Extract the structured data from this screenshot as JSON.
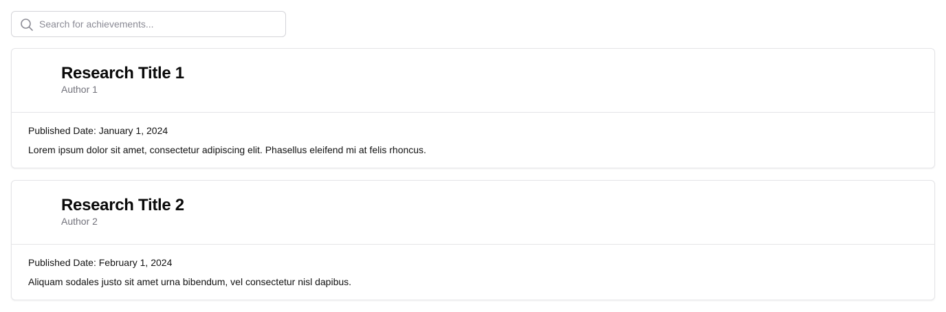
{
  "search": {
    "placeholder": "Search for achievements...",
    "value": "",
    "icon": "search-icon"
  },
  "achievements": [
    {
      "title": "Research Title 1",
      "author": "Author 1",
      "published": "Published Date: January 1, 2024",
      "description": "Lorem ipsum dolor sit amet, consectetur adipiscing elit. Phasellus eleifend mi at felis rhoncus."
    },
    {
      "title": "Research Title 2",
      "author": "Author 2",
      "published": "Published Date: February 1, 2024",
      "description": "Aliquam sodales justo sit amet urna bibendum, vel consectetur nisl dapibus."
    }
  ],
  "colors": {
    "border": "#e4e4e7",
    "muted_text": "#71717a",
    "text": "#111111"
  }
}
